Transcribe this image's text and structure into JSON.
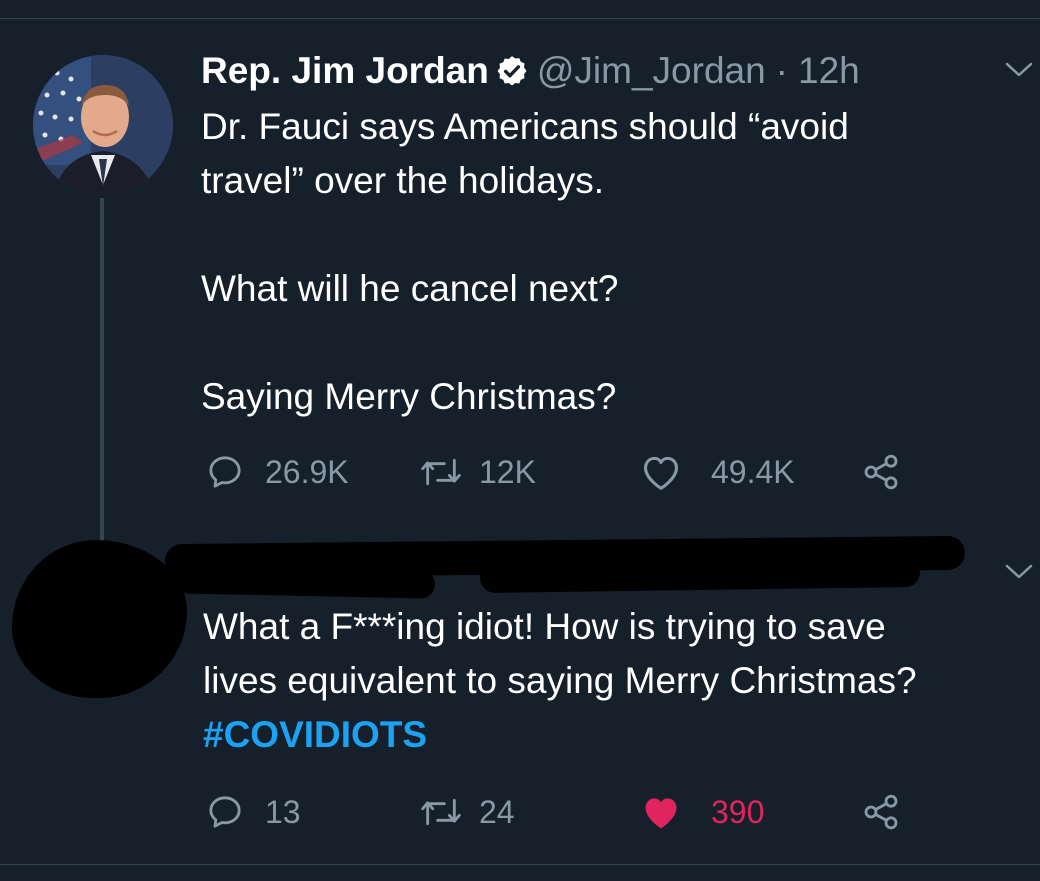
{
  "tweet": {
    "display_name": "Rep. Jim Jordan",
    "handle": "@Jim_Jordan",
    "separator": "·",
    "time": "12h",
    "lines": [
      "Dr. Fauci says Americans should “avoid",
      "travel” over the holidays.",
      "What will he cancel next?",
      "Saying Merry Christmas?"
    ],
    "stats": {
      "replies": "26.9K",
      "retweets": "12K",
      "likes": "49.4K"
    }
  },
  "reply": {
    "lines": [
      "What a F***ing idiot!  How is trying to save",
      "lives equivalent to saying Merry Christmas?"
    ],
    "hashtag": "#COVIDIOTS",
    "stats": {
      "replies": "13",
      "retweets": "24",
      "likes": "390"
    },
    "liked": true
  },
  "colors": {
    "background": "#15202b",
    "secondary_text": "#8899a6",
    "link": "#1da1f2",
    "like_active": "#e0245e",
    "divider": "#38444d"
  }
}
